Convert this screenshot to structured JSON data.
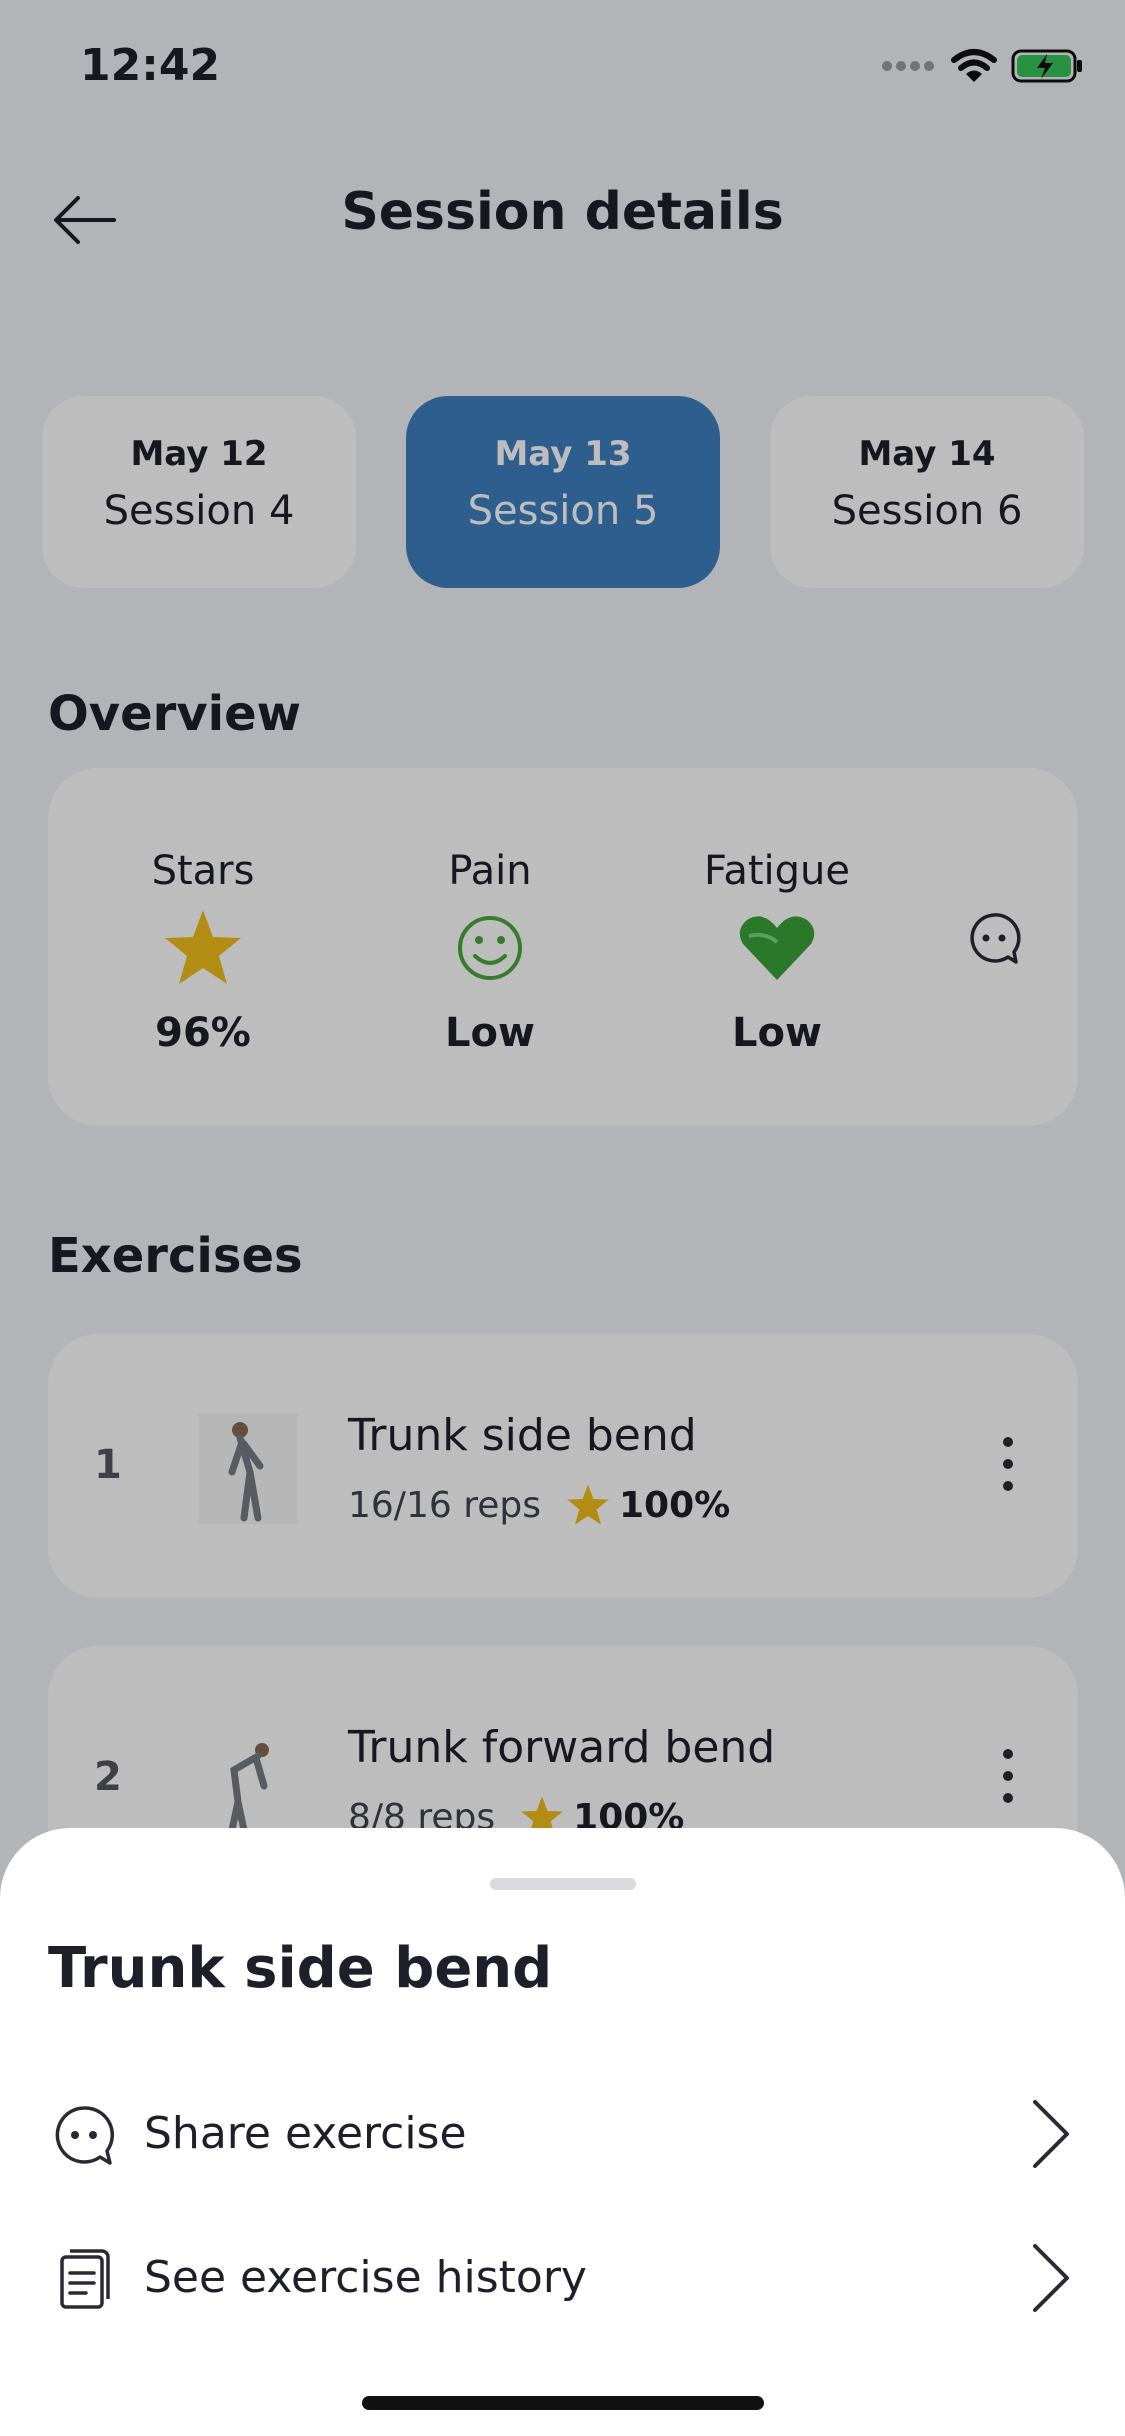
{
  "status_bar": {
    "time": "12:42"
  },
  "header": {
    "title": "Session details"
  },
  "sessions": [
    {
      "date": "May 12",
      "name": "Session 4"
    },
    {
      "date": "May 13",
      "name": "Session 5",
      "active": true
    },
    {
      "date": "May 14",
      "name": "Session 6"
    }
  ],
  "overview": {
    "title": "Overview",
    "stars": {
      "label": "Stars",
      "value": "96%"
    },
    "pain": {
      "label": "Pain",
      "value": "Low"
    },
    "fatigue": {
      "label": "Fatigue",
      "value": "Low"
    }
  },
  "exercises": {
    "title": "Exercises",
    "items": [
      {
        "number": "1",
        "name": "Trunk side bend",
        "reps": "16/16 reps",
        "score": "100%"
      },
      {
        "number": "2",
        "name": "Trunk forward bend",
        "reps": "8/8 reps",
        "score": "100%"
      }
    ]
  },
  "sheet": {
    "title": "Trunk side bend",
    "actions": [
      {
        "label": "Share exercise",
        "icon": "chat-icon"
      },
      {
        "label": "See exercise history",
        "icon": "document-icon"
      }
    ]
  },
  "colors": {
    "accent": "#3d7fc0",
    "star": "#f2bf1a",
    "pain_green": "#4aa83c",
    "fatigue_green": "#3aa33a",
    "battery_green": "#35c759"
  }
}
